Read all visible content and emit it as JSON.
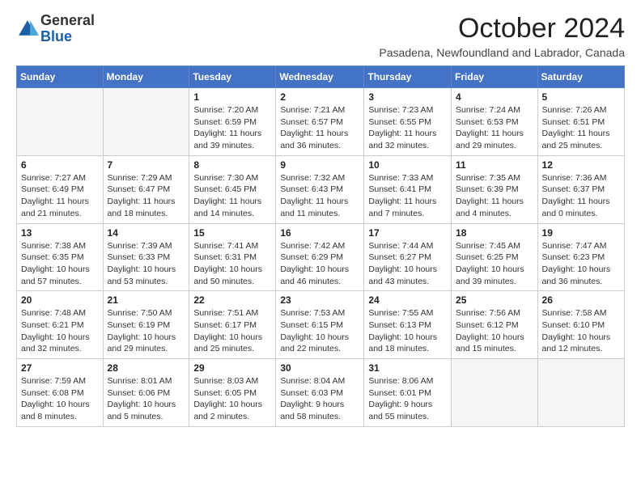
{
  "header": {
    "logo_general": "General",
    "logo_blue": "Blue",
    "month": "October 2024",
    "location": "Pasadena, Newfoundland and Labrador, Canada"
  },
  "weekdays": [
    "Sunday",
    "Monday",
    "Tuesday",
    "Wednesday",
    "Thursday",
    "Friday",
    "Saturday"
  ],
  "weeks": [
    [
      {
        "day": "",
        "sunrise": "",
        "sunset": "",
        "daylight": "",
        "empty": true
      },
      {
        "day": "",
        "sunrise": "",
        "sunset": "",
        "daylight": "",
        "empty": true
      },
      {
        "day": "1",
        "sunrise": "Sunrise: 7:20 AM",
        "sunset": "Sunset: 6:59 PM",
        "daylight": "Daylight: 11 hours and 39 minutes.",
        "empty": false
      },
      {
        "day": "2",
        "sunrise": "Sunrise: 7:21 AM",
        "sunset": "Sunset: 6:57 PM",
        "daylight": "Daylight: 11 hours and 36 minutes.",
        "empty": false
      },
      {
        "day": "3",
        "sunrise": "Sunrise: 7:23 AM",
        "sunset": "Sunset: 6:55 PM",
        "daylight": "Daylight: 11 hours and 32 minutes.",
        "empty": false
      },
      {
        "day": "4",
        "sunrise": "Sunrise: 7:24 AM",
        "sunset": "Sunset: 6:53 PM",
        "daylight": "Daylight: 11 hours and 29 minutes.",
        "empty": false
      },
      {
        "day": "5",
        "sunrise": "Sunrise: 7:26 AM",
        "sunset": "Sunset: 6:51 PM",
        "daylight": "Daylight: 11 hours and 25 minutes.",
        "empty": false
      }
    ],
    [
      {
        "day": "6",
        "sunrise": "Sunrise: 7:27 AM",
        "sunset": "Sunset: 6:49 PM",
        "daylight": "Daylight: 11 hours and 21 minutes.",
        "empty": false
      },
      {
        "day": "7",
        "sunrise": "Sunrise: 7:29 AM",
        "sunset": "Sunset: 6:47 PM",
        "daylight": "Daylight: 11 hours and 18 minutes.",
        "empty": false
      },
      {
        "day": "8",
        "sunrise": "Sunrise: 7:30 AM",
        "sunset": "Sunset: 6:45 PM",
        "daylight": "Daylight: 11 hours and 14 minutes.",
        "empty": false
      },
      {
        "day": "9",
        "sunrise": "Sunrise: 7:32 AM",
        "sunset": "Sunset: 6:43 PM",
        "daylight": "Daylight: 11 hours and 11 minutes.",
        "empty": false
      },
      {
        "day": "10",
        "sunrise": "Sunrise: 7:33 AM",
        "sunset": "Sunset: 6:41 PM",
        "daylight": "Daylight: 11 hours and 7 minutes.",
        "empty": false
      },
      {
        "day": "11",
        "sunrise": "Sunrise: 7:35 AM",
        "sunset": "Sunset: 6:39 PM",
        "daylight": "Daylight: 11 hours and 4 minutes.",
        "empty": false
      },
      {
        "day": "12",
        "sunrise": "Sunrise: 7:36 AM",
        "sunset": "Sunset: 6:37 PM",
        "daylight": "Daylight: 11 hours and 0 minutes.",
        "empty": false
      }
    ],
    [
      {
        "day": "13",
        "sunrise": "Sunrise: 7:38 AM",
        "sunset": "Sunset: 6:35 PM",
        "daylight": "Daylight: 10 hours and 57 minutes.",
        "empty": false
      },
      {
        "day": "14",
        "sunrise": "Sunrise: 7:39 AM",
        "sunset": "Sunset: 6:33 PM",
        "daylight": "Daylight: 10 hours and 53 minutes.",
        "empty": false
      },
      {
        "day": "15",
        "sunrise": "Sunrise: 7:41 AM",
        "sunset": "Sunset: 6:31 PM",
        "daylight": "Daylight: 10 hours and 50 minutes.",
        "empty": false
      },
      {
        "day": "16",
        "sunrise": "Sunrise: 7:42 AM",
        "sunset": "Sunset: 6:29 PM",
        "daylight": "Daylight: 10 hours and 46 minutes.",
        "empty": false
      },
      {
        "day": "17",
        "sunrise": "Sunrise: 7:44 AM",
        "sunset": "Sunset: 6:27 PM",
        "daylight": "Daylight: 10 hours and 43 minutes.",
        "empty": false
      },
      {
        "day": "18",
        "sunrise": "Sunrise: 7:45 AM",
        "sunset": "Sunset: 6:25 PM",
        "daylight": "Daylight: 10 hours and 39 minutes.",
        "empty": false
      },
      {
        "day": "19",
        "sunrise": "Sunrise: 7:47 AM",
        "sunset": "Sunset: 6:23 PM",
        "daylight": "Daylight: 10 hours and 36 minutes.",
        "empty": false
      }
    ],
    [
      {
        "day": "20",
        "sunrise": "Sunrise: 7:48 AM",
        "sunset": "Sunset: 6:21 PM",
        "daylight": "Daylight: 10 hours and 32 minutes.",
        "empty": false
      },
      {
        "day": "21",
        "sunrise": "Sunrise: 7:50 AM",
        "sunset": "Sunset: 6:19 PM",
        "daylight": "Daylight: 10 hours and 29 minutes.",
        "empty": false
      },
      {
        "day": "22",
        "sunrise": "Sunrise: 7:51 AM",
        "sunset": "Sunset: 6:17 PM",
        "daylight": "Daylight: 10 hours and 25 minutes.",
        "empty": false
      },
      {
        "day": "23",
        "sunrise": "Sunrise: 7:53 AM",
        "sunset": "Sunset: 6:15 PM",
        "daylight": "Daylight: 10 hours and 22 minutes.",
        "empty": false
      },
      {
        "day": "24",
        "sunrise": "Sunrise: 7:55 AM",
        "sunset": "Sunset: 6:13 PM",
        "daylight": "Daylight: 10 hours and 18 minutes.",
        "empty": false
      },
      {
        "day": "25",
        "sunrise": "Sunrise: 7:56 AM",
        "sunset": "Sunset: 6:12 PM",
        "daylight": "Daylight: 10 hours and 15 minutes.",
        "empty": false
      },
      {
        "day": "26",
        "sunrise": "Sunrise: 7:58 AM",
        "sunset": "Sunset: 6:10 PM",
        "daylight": "Daylight: 10 hours and 12 minutes.",
        "empty": false
      }
    ],
    [
      {
        "day": "27",
        "sunrise": "Sunrise: 7:59 AM",
        "sunset": "Sunset: 6:08 PM",
        "daylight": "Daylight: 10 hours and 8 minutes.",
        "empty": false
      },
      {
        "day": "28",
        "sunrise": "Sunrise: 8:01 AM",
        "sunset": "Sunset: 6:06 PM",
        "daylight": "Daylight: 10 hours and 5 minutes.",
        "empty": false
      },
      {
        "day": "29",
        "sunrise": "Sunrise: 8:03 AM",
        "sunset": "Sunset: 6:05 PM",
        "daylight": "Daylight: 10 hours and 2 minutes.",
        "empty": false
      },
      {
        "day": "30",
        "sunrise": "Sunrise: 8:04 AM",
        "sunset": "Sunset: 6:03 PM",
        "daylight": "Daylight: 9 hours and 58 minutes.",
        "empty": false
      },
      {
        "day": "31",
        "sunrise": "Sunrise: 8:06 AM",
        "sunset": "Sunset: 6:01 PM",
        "daylight": "Daylight: 9 hours and 55 minutes.",
        "empty": false
      },
      {
        "day": "",
        "sunrise": "",
        "sunset": "",
        "daylight": "",
        "empty": true
      },
      {
        "day": "",
        "sunrise": "",
        "sunset": "",
        "daylight": "",
        "empty": true
      }
    ]
  ]
}
